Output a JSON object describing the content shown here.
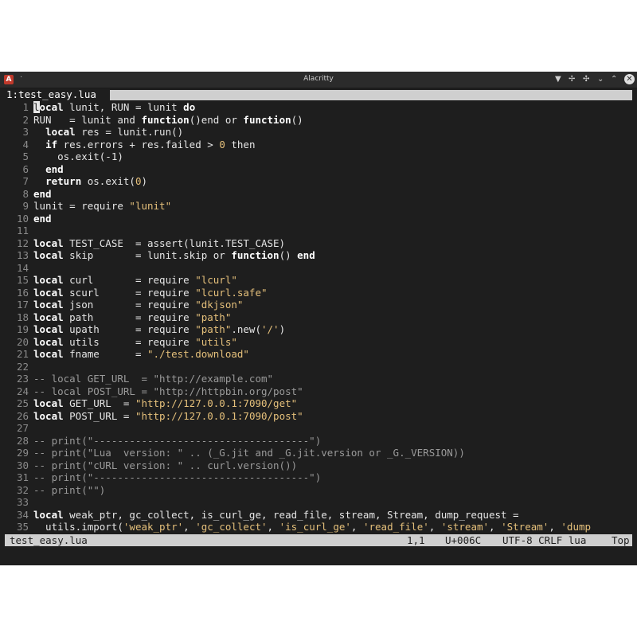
{
  "window": {
    "title": "Alacritty"
  },
  "tabline": {
    "active_tab": "1:test_easy.lua"
  },
  "editor": {
    "lines": [
      {
        "n": "1",
        "t": [
          [
            "kw",
            "local"
          ],
          [
            "",
            "lunit, RUN = lunit "
          ],
          [
            "kw",
            "do"
          ]
        ]
      },
      {
        "n": "2",
        "t": [
          [
            "",
            "RUN   = lunit and "
          ],
          [
            "kw",
            "function"
          ],
          [
            "",
            "()end or "
          ],
          [
            "kw",
            "function"
          ],
          [
            "",
            "()"
          ]
        ]
      },
      {
        "n": "3",
        "t": [
          [
            "",
            "  "
          ],
          [
            "kw",
            "local"
          ],
          [
            "",
            "res = lunit.run()"
          ]
        ]
      },
      {
        "n": "4",
        "t": [
          [
            "",
            "  "
          ],
          [
            "kw",
            "if"
          ],
          [
            "",
            "res.errors + res.failed > "
          ],
          [
            "num",
            "0"
          ],
          [
            "",
            "then"
          ]
        ]
      },
      {
        "n": "5",
        "t": [
          [
            "",
            "    os.exit(-1)"
          ]
        ]
      },
      {
        "n": "6",
        "t": [
          [
            "",
            "  "
          ],
          [
            "kw",
            "end"
          ]
        ]
      },
      {
        "n": "7",
        "t": [
          [
            "",
            "  "
          ],
          [
            "kw",
            "return"
          ],
          [
            "",
            "os.exit("
          ],
          [
            "num",
            "0"
          ],
          [
            "",
            ")"
          ]
        ]
      },
      {
        "n": "8",
        "t": [
          [
            "kw",
            "end"
          ]
        ]
      },
      {
        "n": "9",
        "t": [
          [
            "",
            "lunit = require "
          ],
          [
            "str",
            "\"lunit\""
          ]
        ]
      },
      {
        "n": "10",
        "t": [
          [
            "kw",
            "end"
          ]
        ]
      },
      {
        "n": "11",
        "t": []
      },
      {
        "n": "12",
        "t": [
          [
            "kw",
            "local"
          ],
          [
            "",
            "TEST_CASE  = assert(lunit.TEST_CASE)"
          ]
        ]
      },
      {
        "n": "13",
        "t": [
          [
            "kw",
            "local"
          ],
          [
            "",
            "skip       = lunit.skip or "
          ],
          [
            "kw",
            "function"
          ],
          [
            "",
            "() "
          ],
          [
            "kw",
            "end"
          ]
        ]
      },
      {
        "n": "14",
        "t": []
      },
      {
        "n": "15",
        "t": [
          [
            "kw",
            "local"
          ],
          [
            "",
            "curl       = require "
          ],
          [
            "str",
            "\"lcurl\""
          ]
        ]
      },
      {
        "n": "16",
        "t": [
          [
            "kw",
            "local"
          ],
          [
            "",
            "scurl      = require "
          ],
          [
            "str",
            "\"lcurl.safe\""
          ]
        ]
      },
      {
        "n": "17",
        "t": [
          [
            "kw",
            "local"
          ],
          [
            "",
            "json       = require "
          ],
          [
            "str",
            "\"dkjson\""
          ]
        ]
      },
      {
        "n": "18",
        "t": [
          [
            "kw",
            "local"
          ],
          [
            "",
            "path       = require "
          ],
          [
            "str",
            "\"path\""
          ]
        ]
      },
      {
        "n": "19",
        "t": [
          [
            "kw",
            "local"
          ],
          [
            "",
            "upath      = require "
          ],
          [
            "str",
            "\"path\""
          ],
          [
            "",
            ".new("
          ],
          [
            "str",
            "'/'"
          ],
          [
            "",
            ")"
          ]
        ]
      },
      {
        "n": "20",
        "t": [
          [
            "kw",
            "local"
          ],
          [
            "",
            "utils      = require "
          ],
          [
            "str",
            "\"utils\""
          ]
        ]
      },
      {
        "n": "21",
        "t": [
          [
            "kw",
            "local"
          ],
          [
            "",
            "fname      = "
          ],
          [
            "str",
            "\"./test.download\""
          ]
        ]
      },
      {
        "n": "22",
        "t": []
      },
      {
        "n": "23",
        "t": [
          [
            "cmt",
            "-- local GET_URL  = \"http://example.com\""
          ]
        ]
      },
      {
        "n": "24",
        "t": [
          [
            "cmt",
            "-- local POST_URL = \"http://httpbin.org/post\""
          ]
        ]
      },
      {
        "n": "25",
        "t": [
          [
            "kw",
            "local"
          ],
          [
            "",
            "GET_URL  = "
          ],
          [
            "str",
            "\"http://127.0.0.1:7090/get\""
          ]
        ]
      },
      {
        "n": "26",
        "t": [
          [
            "kw",
            "local"
          ],
          [
            "",
            "POST_URL = "
          ],
          [
            "str",
            "\"http://127.0.0.1:7090/post\""
          ]
        ]
      },
      {
        "n": "27",
        "t": []
      },
      {
        "n": "28",
        "t": [
          [
            "cmt",
            "-- print(\"------------------------------------\")"
          ]
        ]
      },
      {
        "n": "29",
        "t": [
          [
            "cmt",
            "-- print(\"Lua  version: \" .. (_G.jit and _G.jit.version or _G._VERSION))"
          ]
        ]
      },
      {
        "n": "30",
        "t": [
          [
            "cmt",
            "-- print(\"cURL version: \" .. curl.version())"
          ]
        ]
      },
      {
        "n": "31",
        "t": [
          [
            "cmt",
            "-- print(\"------------------------------------\")"
          ]
        ]
      },
      {
        "n": "32",
        "t": [
          [
            "cmt",
            "-- print(\"\")"
          ]
        ]
      },
      {
        "n": "33",
        "t": []
      },
      {
        "n": "34",
        "t": [
          [
            "kw",
            "local"
          ],
          [
            "",
            "weak_ptr, gc_collect, is_curl_ge, read_file, stream, Stream, dump_request ="
          ]
        ]
      },
      {
        "n": "35",
        "t": [
          [
            "",
            "  utils.import("
          ],
          [
            "str",
            "'weak_ptr'"
          ],
          [
            "",
            ", "
          ],
          [
            "str",
            "'gc_collect'"
          ],
          [
            "",
            ", "
          ],
          [
            "str",
            "'is_curl_ge'"
          ],
          [
            "",
            ", "
          ],
          [
            "str",
            "'read_file'"
          ],
          [
            "",
            ", "
          ],
          [
            "str",
            "'stream'"
          ],
          [
            "",
            ", "
          ],
          [
            "str",
            "'Stream'"
          ],
          [
            "",
            ", "
          ],
          [
            "str",
            "'dump"
          ]
        ]
      }
    ]
  },
  "statusbar": {
    "file": "test_easy.lua",
    "position": "1,1",
    "char": "U+006C",
    "info": "UTF-8 CRLF lua",
    "scroll": "Top"
  }
}
